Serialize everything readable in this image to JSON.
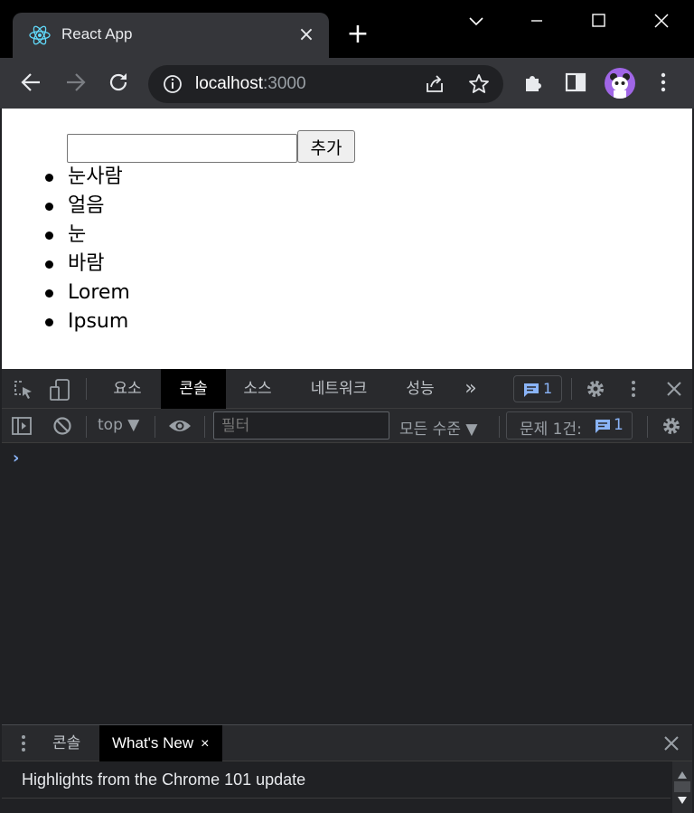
{
  "browser": {
    "tab_title": "React App",
    "tab_close": "×",
    "new_tab": "+",
    "url_host": "localhost",
    "url_port": ":3000"
  },
  "page": {
    "input_value": "",
    "add_button_label": "추가",
    "items": [
      "눈사람",
      "얼음",
      "눈",
      "바람",
      "Lorem",
      "Ipsum"
    ]
  },
  "devtools": {
    "tabs": [
      "요소",
      "콘솔",
      "소스",
      "네트워크",
      "성능"
    ],
    "active_tab": "콘솔",
    "more_tabs": "»",
    "issues_count": "1",
    "console": {
      "context": "top ▼",
      "filter_placeholder": "필터",
      "levels": "모든 수준 ▼",
      "issues_label": "문제 1건:",
      "issues_count": "1",
      "prompt": "›"
    },
    "drawer": {
      "tab_console": "콘솔",
      "tab_whats_new": "What's New",
      "close_mark": "×",
      "whats_new_text": "Highlights from the Chrome 101 update"
    }
  },
  "colors": {
    "accent": "#8ab4f8",
    "avatar": "#a066e6"
  }
}
